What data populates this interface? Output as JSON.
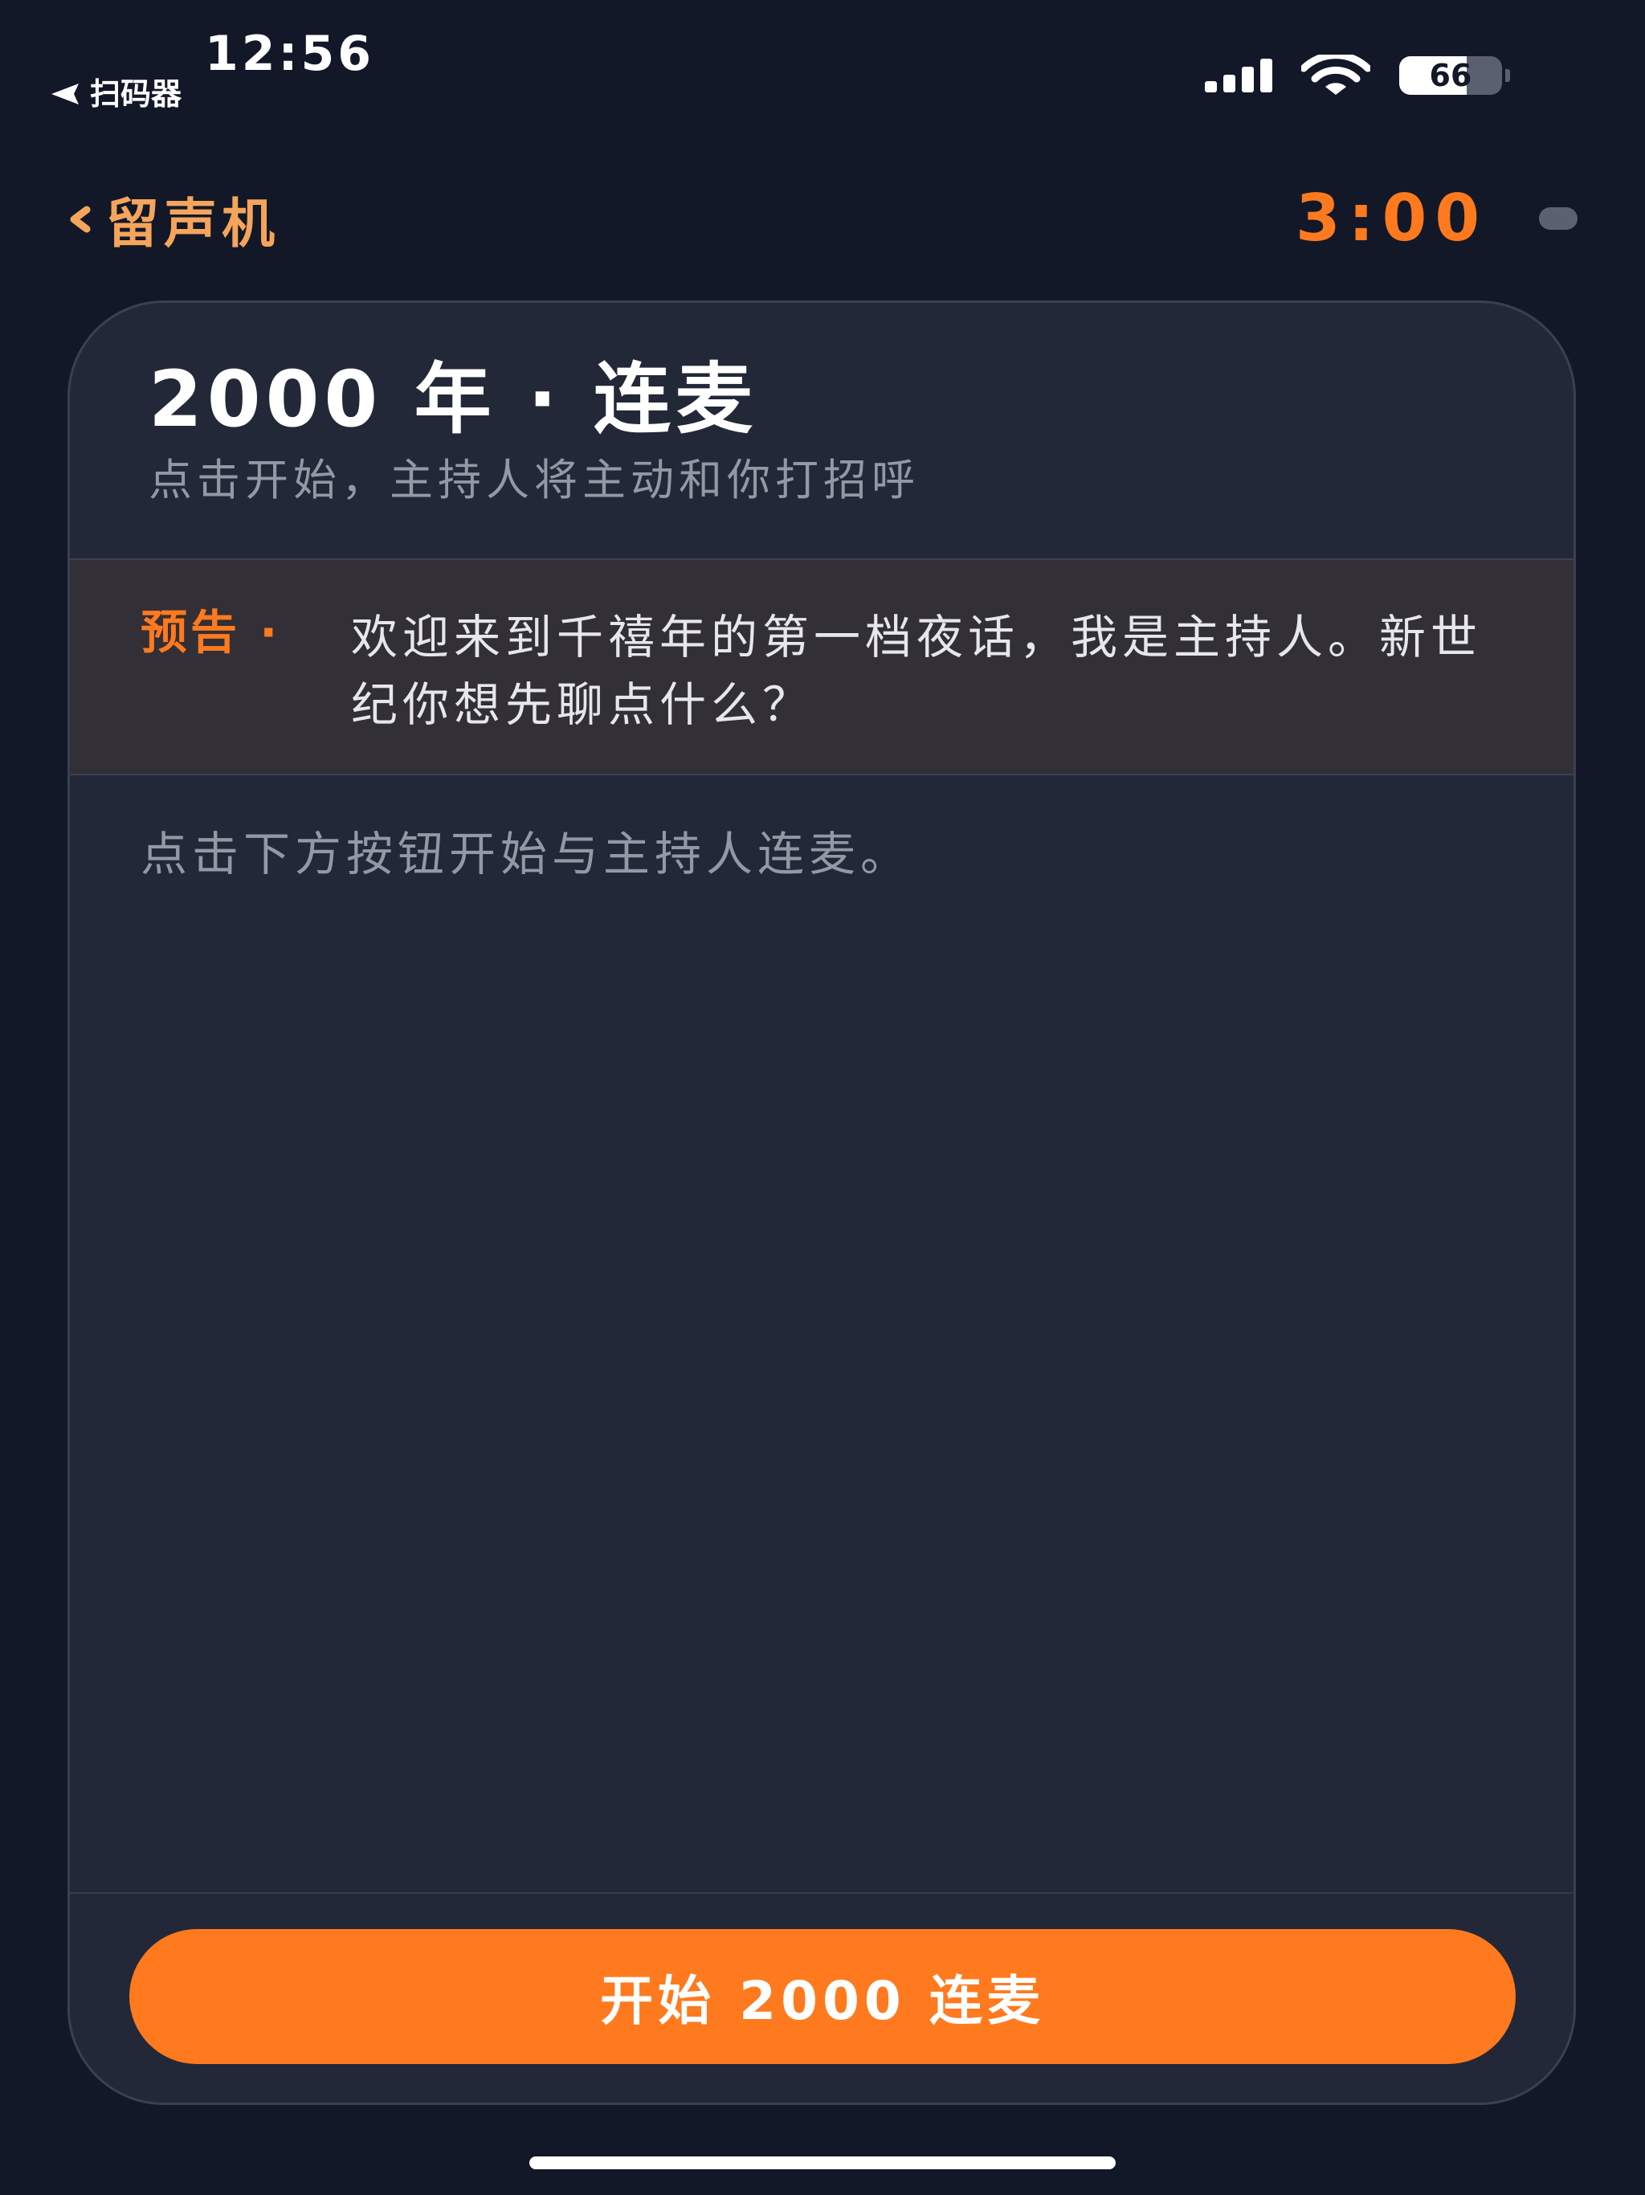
{
  "status_bar": {
    "time": "12:56",
    "back_app": "扫码器",
    "battery": "66",
    "battery_level": 0.66
  },
  "nav": {
    "title": "留声机",
    "timer": "3:00"
  },
  "card": {
    "title": "2000 年 · 连麦",
    "subtitle": "点击开始，主持人将主动和你打招呼",
    "preview_tag": "预告 ·",
    "preview_text": "欢迎来到千禧年的第一档夜话，我是主持人。新世纪你想先聊点什么？",
    "hint": "点击下方按钮开始与主持人连麦。",
    "button_label": "开始 2000 连麦"
  },
  "colors": {
    "accent": "#FF7A1E",
    "back_label": "#F5A55B",
    "background": "#121828",
    "card": "#222837",
    "preview_bg": "#322F36"
  }
}
